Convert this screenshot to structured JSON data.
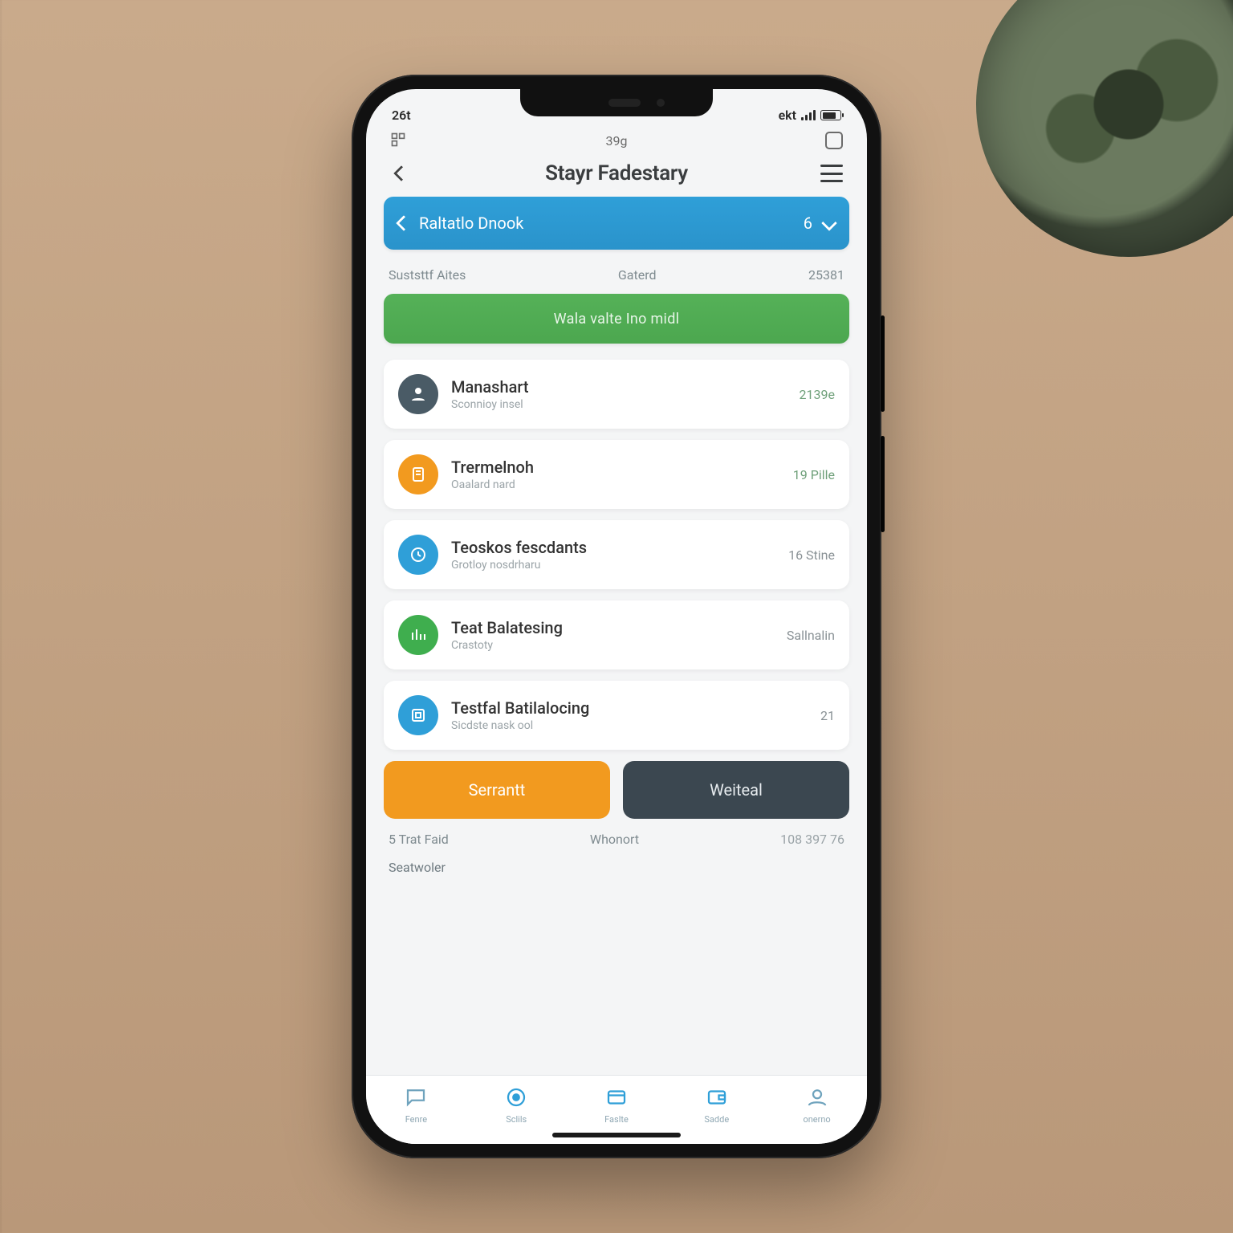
{
  "status": {
    "time_left": "26t",
    "carrier": "ekt"
  },
  "subbar": {
    "center": "39g"
  },
  "header": {
    "title": "Stayr Fadestary"
  },
  "pill": {
    "label": "Raltatlo Dnook",
    "count": "6"
  },
  "labels": {
    "a": "Suststtf Aites",
    "b": "Gaterd",
    "c": "25381"
  },
  "green": {
    "label": "Wala valte Ino midl"
  },
  "items": [
    {
      "title": "Manashart",
      "sub": "Sconnioy insel",
      "meta": "2139e",
      "color": "c-slate"
    },
    {
      "title": "Trermelnoh",
      "sub": "Oaalard nard",
      "meta": "19 Pille",
      "color": "c-orange"
    },
    {
      "title": "Teoskos fescdants",
      "sub": "Grotloy nosdrharu",
      "meta": "16 Stine",
      "color": "c-blue"
    },
    {
      "title": "Teat Balatesing",
      "sub": "Crastoty",
      "meta": "Sallnalin",
      "color": "c-green"
    },
    {
      "title": "Testfal Batilalocing",
      "sub": "Sicdste nask ool",
      "meta": "21",
      "color": "c-blue2"
    }
  ],
  "buttons": {
    "left": "Serrantt",
    "right": "Weiteal"
  },
  "footer": {
    "a": "5 Trat Faid",
    "b": "Whonort",
    "c": "108 397 76"
  },
  "section": {
    "label": "Seatwoler"
  },
  "tabs": [
    {
      "label": "Fenre"
    },
    {
      "label": "Sclils"
    },
    {
      "label": "Faslte"
    },
    {
      "label": "Sadde"
    },
    {
      "label": "onerno"
    }
  ]
}
